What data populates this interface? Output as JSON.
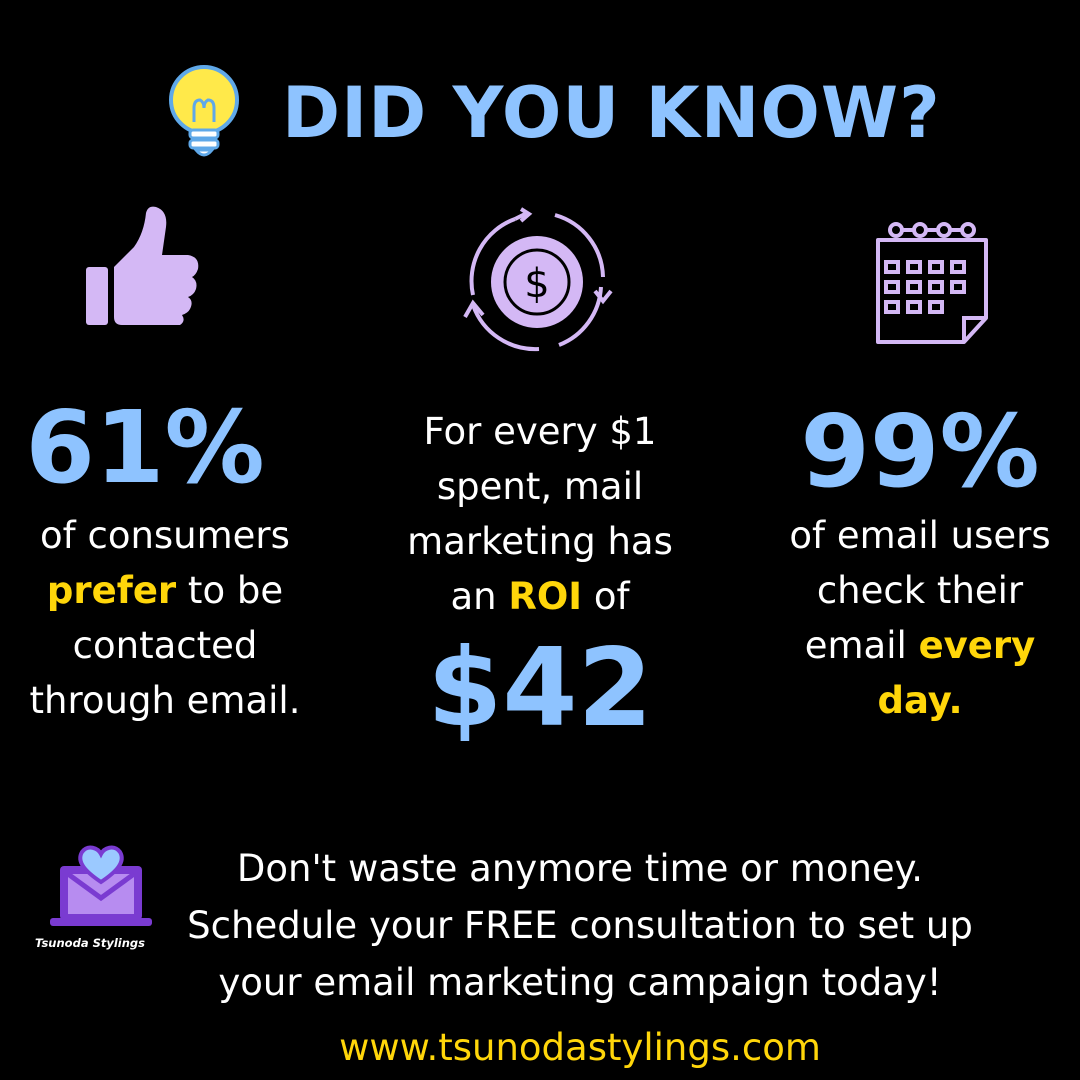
{
  "header": {
    "title": "DID YOU KNOW?",
    "icon": "lightbulb-icon"
  },
  "stats": [
    {
      "icon": "thumbs-up-icon",
      "value": "61%",
      "text_line1": "of consumers",
      "text_line2_highlight": "prefer",
      "text_line2_rest": " to be",
      "text_line3": "contacted",
      "text_line4": "through email."
    },
    {
      "icon": "dollar-cycle-icon",
      "text_line1": "For every $1",
      "text_line2": "spent, mail",
      "text_line3": "marketing has",
      "text_line4_pre": "an ",
      "text_line4_highlight": "ROI",
      "text_line4_post": " of",
      "value": "$42"
    },
    {
      "icon": "calendar-icon",
      "value": "99%",
      "text_line1": "of email users",
      "text_line2": "check their",
      "text_line3_pre": "email ",
      "text_line3_highlight": "every",
      "text_line4_highlight": "day."
    }
  ],
  "footer": {
    "logo_icon": "laptop-heart-logo-icon",
    "brand": "Tsunoda Stylings",
    "cta_line1": "Don't waste anymore time or money.",
    "cta_line2": "Schedule your FREE consultation to set up",
    "cta_line3": "your email marketing campaign today!",
    "website": "www.tsunodastylings.com"
  },
  "colors": {
    "background": "#000000",
    "accent_blue": "#8ec3ff",
    "accent_yellow": "#ffd60a",
    "icon_lavender": "#d4b8f5",
    "logo_purple": "#7a3bd1"
  }
}
